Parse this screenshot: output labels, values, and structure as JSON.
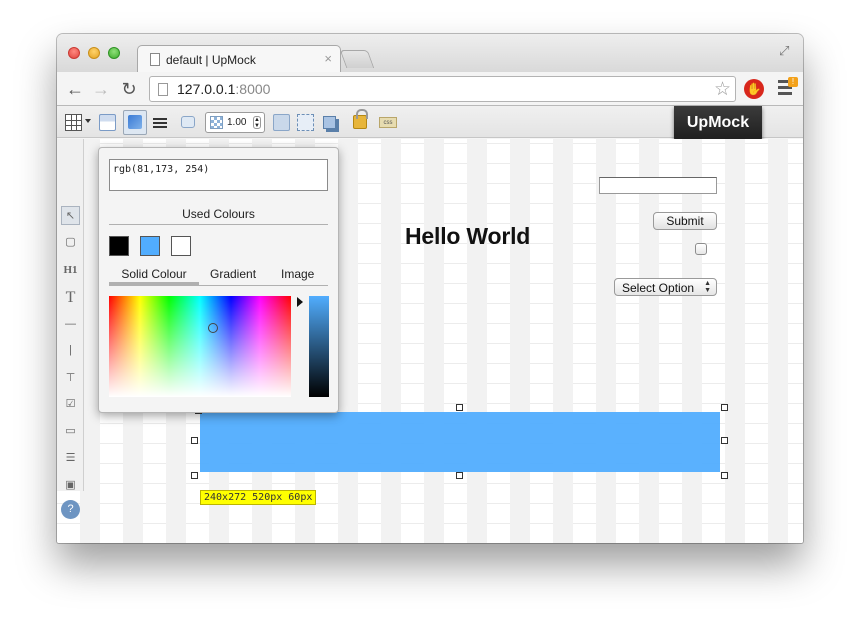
{
  "browser": {
    "tab_title": "default | UpMock",
    "tab_close": "×",
    "url_host": "127.0.0.1",
    "url_port": ":8000",
    "nav": {
      "back": "←",
      "forward": "→",
      "reload": "↻"
    },
    "star": "☆",
    "fullscreen": "⤢"
  },
  "toolbar": {
    "opacity_value": "1.00",
    "css_label": "css",
    "brand": "UpMock"
  },
  "sidebar": {
    "tools": [
      "pointer",
      "rectangle",
      "H1",
      "T",
      "—",
      "|",
      "label",
      "☑",
      "button",
      "list",
      "image",
      "?"
    ]
  },
  "canvas": {
    "heading": "Hello World",
    "submit_label": "Submit",
    "select_label": "Select Option",
    "selection_info": "240x272 520px 60px",
    "rect_color": "#51adfe"
  },
  "color_picker": {
    "value": "rgb(81,173, 254)",
    "used_colours_title": "Used Colours",
    "used_colours": [
      "#000000",
      "#51adfe",
      "#ffffff"
    ],
    "tabs": [
      "Solid Colour",
      "Gradient",
      "Image"
    ],
    "active_tab": "Solid Colour"
  },
  "colors": {
    "accent_blue": "#51adfe",
    "brand_bg": "#2a2a2a",
    "selection_label_bg": "#ffff00"
  }
}
